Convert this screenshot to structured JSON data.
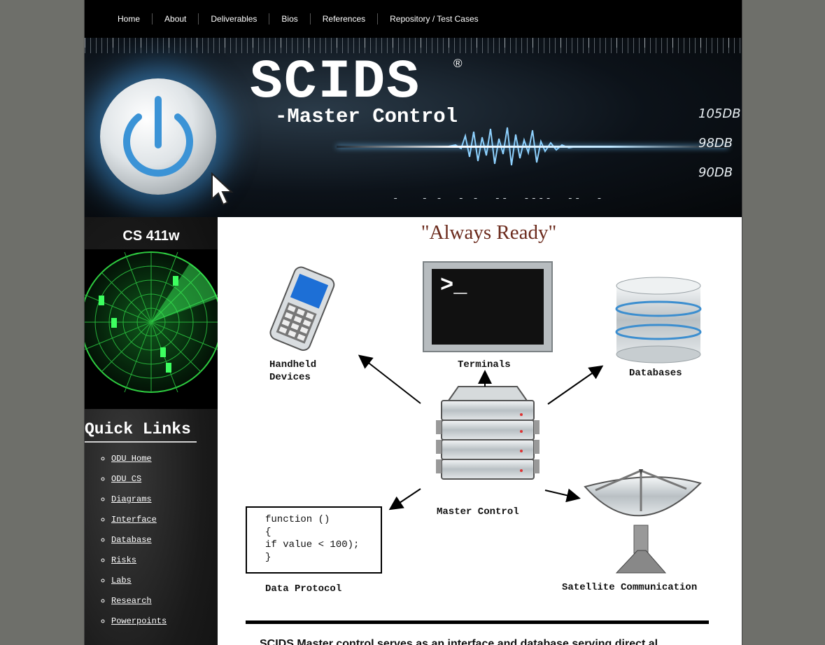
{
  "nav": {
    "items": [
      "Home",
      "About",
      "Deliverables",
      "Bios",
      "References",
      "Repository / Test Cases"
    ]
  },
  "banner": {
    "title": "SCIDS",
    "registered": "®",
    "subtitle": "-Master Control",
    "readouts": [
      "105DB",
      "98DB",
      "90DB"
    ]
  },
  "sidebar": {
    "course": "CS 411w",
    "quick_links_title": "Quick Links",
    "links": [
      "ODU Home",
      "ODU CS",
      "Diagrams",
      "Interface",
      "Database",
      "Risks",
      "Labs",
      "Research",
      "Powerpoints"
    ]
  },
  "main": {
    "tagline": "\"Always Ready\"",
    "diagram": {
      "handheld_line1": "Handheld",
      "handheld_line2": "Devices",
      "terminals": "Terminals",
      "databases": "Databases",
      "master_control": "Master Control",
      "satellite": "Satellite Communication",
      "data_protocol": "Data Protocol",
      "terminal_prompt": ">_",
      "code_lines": [
        "function ()",
        "{",
        "if value < 100);",
        "}"
      ]
    },
    "paragraph": "SCIDS Master control serves as an interface and database serving direct al"
  }
}
